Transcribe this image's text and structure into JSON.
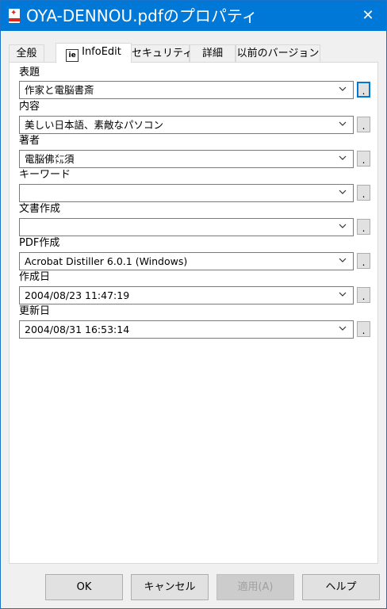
{
  "window": {
    "title": "OYA-DENNOU.pdfのプロパティ",
    "close_glyph": "✕"
  },
  "tabs": [
    {
      "label": "全般"
    },
    {
      "label": "InfoEdit",
      "icon_text": "ie"
    },
    {
      "label": "セキュリティ"
    },
    {
      "label": "詳細"
    },
    {
      "label": "以前のバージョン"
    }
  ],
  "fields": [
    {
      "label": "表題",
      "value": "作家と電脳書斎"
    },
    {
      "label": "内容",
      "value": "美しい日本語、素敵なパソコン"
    },
    {
      "label": "著者",
      "value": "電脳佛㍍須"
    },
    {
      "label": "キーワード",
      "value": ""
    },
    {
      "label": "文書作成",
      "value": ""
    },
    {
      "label": "PDF作成",
      "value": "Acrobat Distiller 6.0.1 (Windows)"
    },
    {
      "label": "作成日",
      "value": "2004/08/23 11:47:19"
    },
    {
      "label": "更新日",
      "value": "2004/08/31 16:53:14"
    }
  ],
  "field_button_label": ".",
  "buttons": {
    "ok": "OK",
    "cancel": "キャンセル",
    "apply": "適用(A)",
    "help": "ヘルプ"
  }
}
